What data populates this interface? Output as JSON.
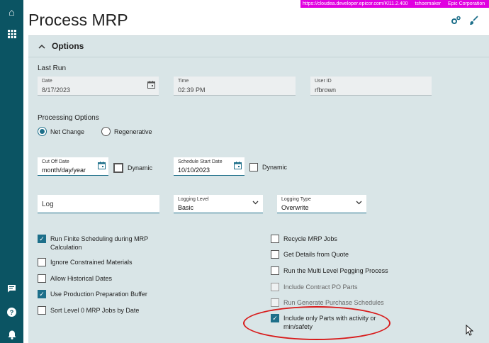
{
  "app": {
    "title": "Process MRP",
    "infobar": [
      "https://cloudea.developer.epicor.com/Kl11.2.400",
      "tshoemaker",
      "Epic Corporation"
    ]
  },
  "icons": {
    "home": "⌂",
    "apps": "▦",
    "chat": "▤",
    "help": "?",
    "bell": "🔔",
    "settings": "⚙",
    "brush": "✎",
    "calendar": "▣",
    "chevron_up": "^",
    "dropdown": "⌄",
    "check": "✓",
    "cursor": "↖"
  },
  "options": {
    "title": "Options"
  },
  "last_run": {
    "label": "Last Run",
    "date_label": "Date",
    "date_value": "8/17/2023",
    "time_label": "Time",
    "time_value": "02:39 PM",
    "user_label": "User ID",
    "user_value": "rfbrown"
  },
  "processing": {
    "label": "Processing Options",
    "net_change": "Net Change",
    "regenerative": "Regenerative"
  },
  "dates": {
    "cutoff_label": "Cut Off Date",
    "cutoff_value": "month/day/year",
    "dynamic1": "Dynamic",
    "schedule_label": "Schedule Start Date",
    "schedule_value": "10/10/2023",
    "dynamic2": "Dynamic"
  },
  "logging": {
    "log_placeholder": "Log",
    "level_label": "Logging Level",
    "level_value": "Basic",
    "type_label": "Logging Type",
    "type_value": "Overwrite"
  },
  "checkboxes_left": [
    {
      "label": "Run Finite Scheduling during MRP Calculation",
      "checked": true
    },
    {
      "label": "Ignore Constrained Materials",
      "checked": false
    },
    {
      "label": "Allow Historical Dates",
      "checked": false
    },
    {
      "label": "Use Production Preparation Buffer",
      "checked": true
    },
    {
      "label": "Sort Level 0 MRP Jobs by Date",
      "checked": false
    }
  ],
  "checkboxes_right": [
    {
      "label": "Recycle MRP Jobs",
      "checked": false
    },
    {
      "label": "Get Details from Quote",
      "checked": false
    },
    {
      "label": "Run the Multi Level Pegging Process",
      "checked": false
    },
    {
      "label": "Include Contract PO Parts",
      "checked": false,
      "disabled": true
    },
    {
      "label": "Run Generate Purchase Schedules",
      "checked": false,
      "disabled": true
    },
    {
      "label": "Include only Parts with activity or min/safety",
      "checked": true
    }
  ],
  "colors": {
    "sidebar": "#0b5463",
    "accent": "#1d6f8a",
    "panel": "#d9e5e7",
    "highlight": "#d81b1b",
    "infobar": "#e000e0"
  }
}
